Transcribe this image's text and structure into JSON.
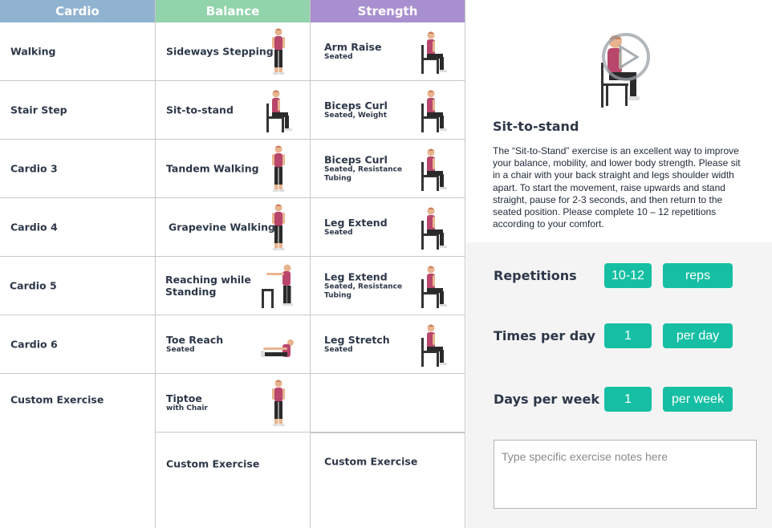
{
  "columns": {
    "cardio": {
      "header": "Cardio",
      "header_color": "#91b3d2",
      "items": [
        {
          "title": "Walking"
        },
        {
          "title": "Stair Step"
        },
        {
          "title": "Cardio 3"
        },
        {
          "title": "Cardio 4"
        },
        {
          "title": "Cardio 5"
        },
        {
          "title": "Cardio 6"
        },
        {
          "title": "Custom Exercise"
        }
      ]
    },
    "balance": {
      "header": "Balance",
      "header_color": "#91d3ab",
      "items": [
        {
          "title": "Sideways Stepping",
          "subtitle": ""
        },
        {
          "title": "Sit-to-stand",
          "subtitle": ""
        },
        {
          "title": "Tandem Walking",
          "subtitle": ""
        },
        {
          "title": "Grapevine Walking",
          "subtitle": ""
        },
        {
          "title": "Reaching while",
          "title2": "Standing",
          "subtitle": ""
        },
        {
          "title": "Toe Reach",
          "subtitle": "Seated"
        },
        {
          "title": "Tiptoe",
          "subtitle": "with Chair"
        },
        {
          "title": "Custom Exercise",
          "subtitle": ""
        }
      ]
    },
    "strength": {
      "header": "Strength",
      "header_color": "#a88fcf",
      "items": [
        {
          "title": "Arm Raise",
          "subtitle": "Seated"
        },
        {
          "title": "Biceps Curl",
          "subtitle": "Seated, Weight"
        },
        {
          "title": "Biceps Curl",
          "subtitle": "Seated, Resistance",
          "subtitle2": "Tubing"
        },
        {
          "title": "Leg Extend",
          "subtitle": "Seated"
        },
        {
          "title": "Leg Extend",
          "subtitle": "Seated, Resistance",
          "subtitle2": "Tubing"
        },
        {
          "title": "Leg Stretch",
          "subtitle": "Seated"
        },
        {
          "title": "Custom Exercise",
          "subtitle": ""
        }
      ]
    }
  },
  "detail": {
    "title": "Sit-to-stand",
    "description": "The “Sit-to-Stand” exercise is an excellent way to improve your balance, mobility, and lower body strength. Please sit in a chair with your back straight and legs shoulder width apart. To start the movement, raise upwards and stand straight, pause for 2-3 seconds, and then return to the seated position. Please complete 10 – 12 repetitions according to your comfort.",
    "video_icon": "play-icon",
    "rows": [
      {
        "label": "Repetitions",
        "value": "10-12",
        "unit": "reps"
      },
      {
        "label": "Times per day",
        "value": "1",
        "unit": "per day"
      },
      {
        "label": "Days per week",
        "value": "1",
        "unit": "per week"
      }
    ],
    "notes_placeholder": "Type specific exercise notes here"
  },
  "colors": {
    "accent": "#16bfa3",
    "figure_top": "#b9466b",
    "figure_pants": "#222222"
  }
}
